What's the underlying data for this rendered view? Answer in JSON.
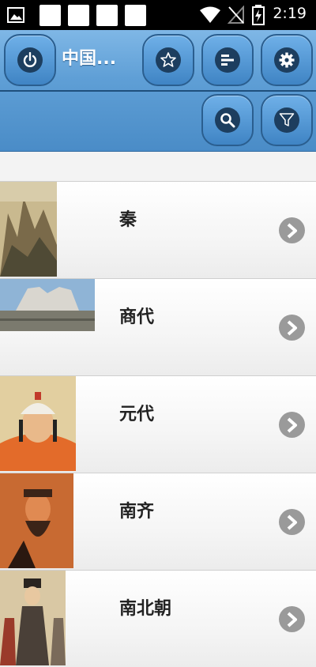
{
  "status_bar": {
    "time": "2:19",
    "icons": [
      "image-notification-icon",
      "notification-square-icon",
      "notification-square-icon",
      "notification-square-icon",
      "notification-square-icon",
      "wifi-icon",
      "no-signal-icon",
      "battery-charging-icon"
    ]
  },
  "header": {
    "title": "中国...",
    "buttons": [
      "power-icon",
      "star-icon",
      "align-left-icon",
      "gear-icon",
      "search-icon",
      "filter-icon"
    ],
    "bg_color": "#5f9fd6"
  },
  "list": {
    "items": [
      {
        "label": "秦",
        "image": "mountain-landscape-painting"
      },
      {
        "label": "商代",
        "image": "stone-statues-photo"
      },
      {
        "label": "元代",
        "image": "emperor-portrait"
      },
      {
        "label": "南齐",
        "image": "scholar-portrait-painting"
      },
      {
        "label": "南北朝",
        "image": "court-figures-painting"
      }
    ]
  }
}
